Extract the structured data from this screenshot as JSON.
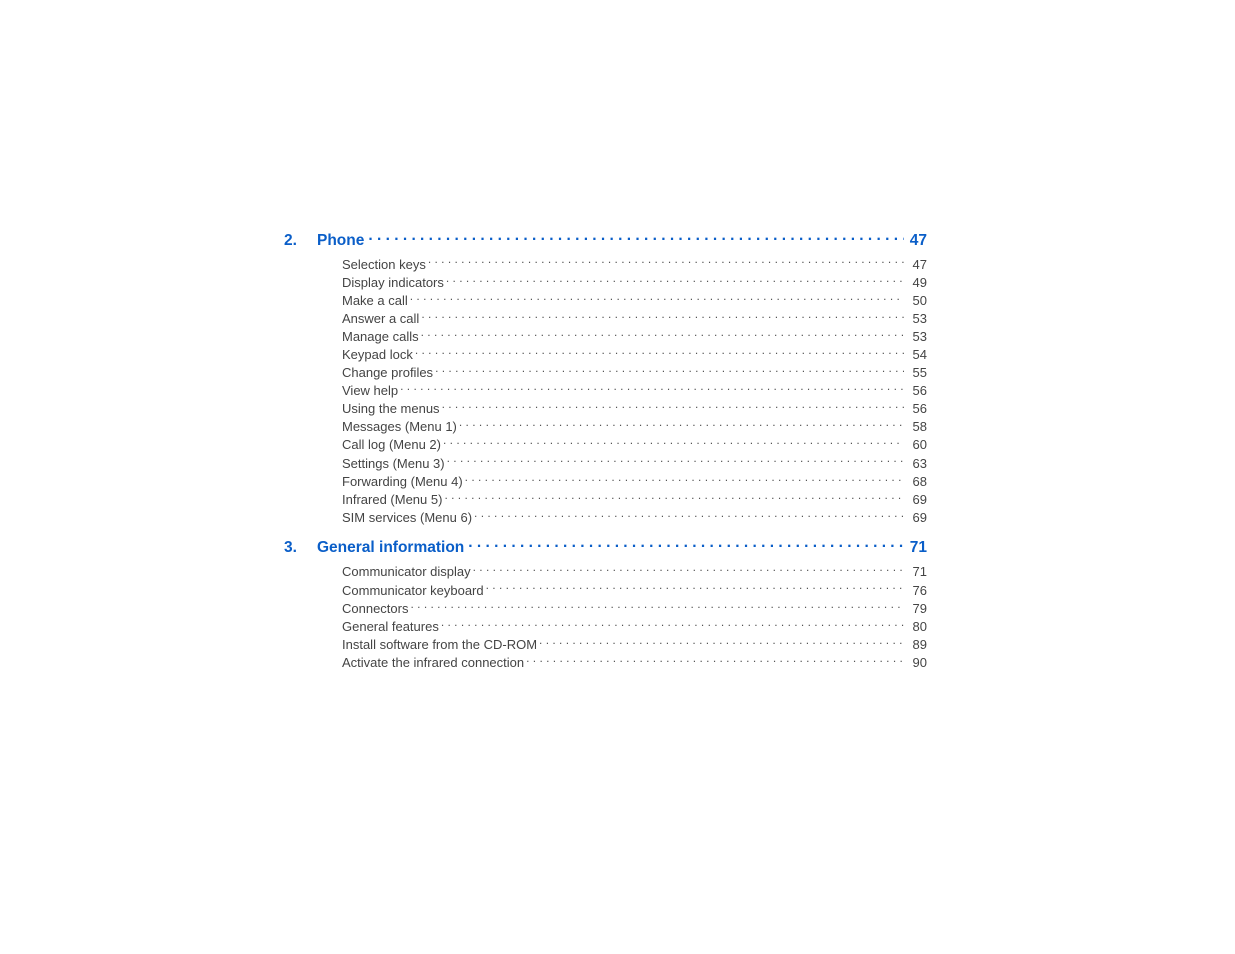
{
  "sections": [
    {
      "number": "2.",
      "title": "Phone",
      "page": "47",
      "entries": [
        {
          "title": "Selection keys",
          "page": "47"
        },
        {
          "title": "Display indicators",
          "page": "49"
        },
        {
          "title": "Make a call",
          "page": "50"
        },
        {
          "title": "Answer a call",
          "page": "53"
        },
        {
          "title": "Manage calls",
          "page": "53"
        },
        {
          "title": "Keypad lock",
          "page": "54"
        },
        {
          "title": "Change profiles",
          "page": "55"
        },
        {
          "title": "View help",
          "page": "56"
        },
        {
          "title": "Using the menus",
          "page": "56"
        },
        {
          "title": "Messages (Menu 1)",
          "page": "58"
        },
        {
          "title": "Call log (Menu 2)",
          "page": "60"
        },
        {
          "title": "Settings (Menu 3)",
          "page": "63"
        },
        {
          "title": "Forwarding (Menu 4)",
          "page": "68"
        },
        {
          "title": "Infrared (Menu 5)",
          "page": "69"
        },
        {
          "title": "SIM services (Menu 6)",
          "page": "69"
        }
      ]
    },
    {
      "number": "3.",
      "title": "General information",
      "page": "71",
      "entries": [
        {
          "title": "Communicator display",
          "page": "71"
        },
        {
          "title": "Communicator keyboard",
          "page": "76"
        },
        {
          "title": "Connectors",
          "page": "79"
        },
        {
          "title": "General features",
          "page": "80"
        },
        {
          "title": "Install software from the CD-ROM",
          "page": "89"
        },
        {
          "title": "Activate the infrared connection",
          "page": "90"
        }
      ]
    }
  ]
}
